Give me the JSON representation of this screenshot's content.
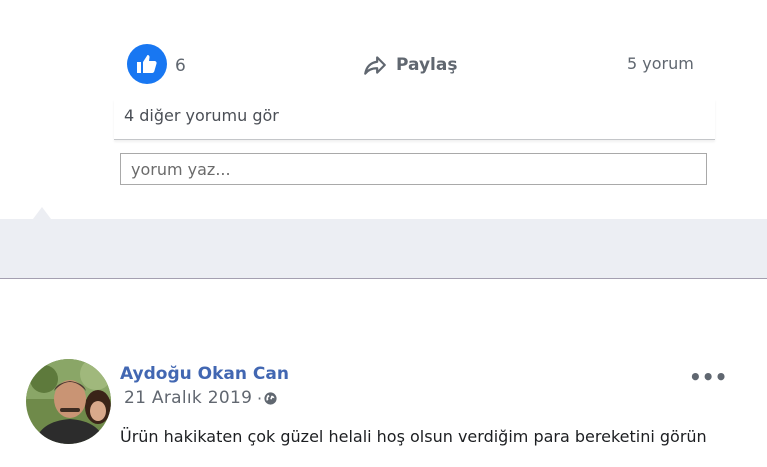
{
  "reactions": {
    "like_count": "6",
    "share_label": "Paylaş",
    "comment_count": "5 yorum"
  },
  "comments": {
    "see_more_label": "4 diğer yorumu gör",
    "input_placeholder": "yorum yaz..."
  },
  "post": {
    "author_name": "Aydoğu Okan Can",
    "date": "21 Aralık 2019",
    "separator": "·",
    "menu_label": "•••",
    "text": "Ürün hakikaten çok güzel helali hoş olsun verdiğim para bereketini görün"
  },
  "colors": {
    "like_blue": "#1877f2",
    "author_blue": "#4267b2",
    "band_grey": "#eceef3"
  },
  "icons": {
    "like": "thumbs-up-icon",
    "share": "share-arrow-icon",
    "privacy": "globe-icon",
    "menu": "more-options-icon"
  }
}
